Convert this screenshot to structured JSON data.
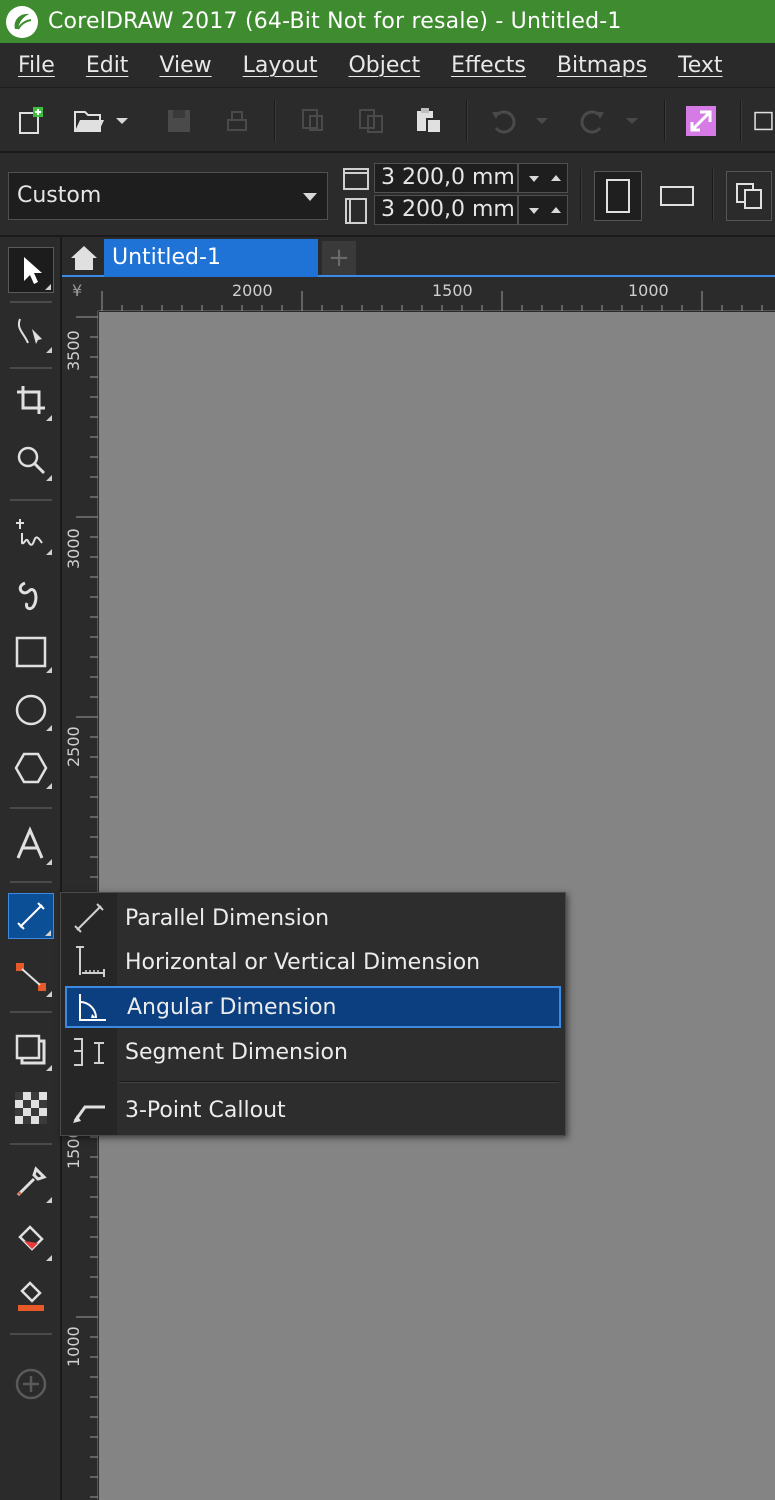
{
  "window": {
    "title": "CorelDRAW 2017 (64-Bit Not for resale) - Untitled-1"
  },
  "menu": {
    "items": [
      "File",
      "Edit",
      "View",
      "Layout",
      "Object",
      "Effects",
      "Bitmaps",
      "Text"
    ]
  },
  "property_bar": {
    "page_size": "Custom",
    "width": "3 200,0 mm",
    "height": "3 200,0 mm"
  },
  "document_tabs": {
    "active": "Untitled-1",
    "new_tab_symbol": "+"
  },
  "rulers": {
    "horizontal_labels": [
      "2000",
      "1500",
      "1000"
    ],
    "vertical_labels": [
      "3500",
      "3000",
      "2500",
      "1500",
      "1000"
    ],
    "unit_symbol": "¥"
  },
  "flyout": {
    "items": [
      {
        "label": "Parallel Dimension",
        "icon": "parallel-dimension-icon"
      },
      {
        "label": "Horizontal or Vertical Dimension",
        "icon": "horizontal-vertical-dimension-icon"
      },
      {
        "label": "Angular Dimension",
        "icon": "angular-dimension-icon",
        "selected": true
      },
      {
        "label": "Segment Dimension",
        "icon": "segment-dimension-icon"
      },
      {
        "label": "3-Point Callout",
        "icon": "three-point-callout-icon"
      }
    ]
  },
  "colors": {
    "titlebar": "#3f8b2f",
    "accent": "#1f73d6",
    "canvas": "#848484"
  }
}
